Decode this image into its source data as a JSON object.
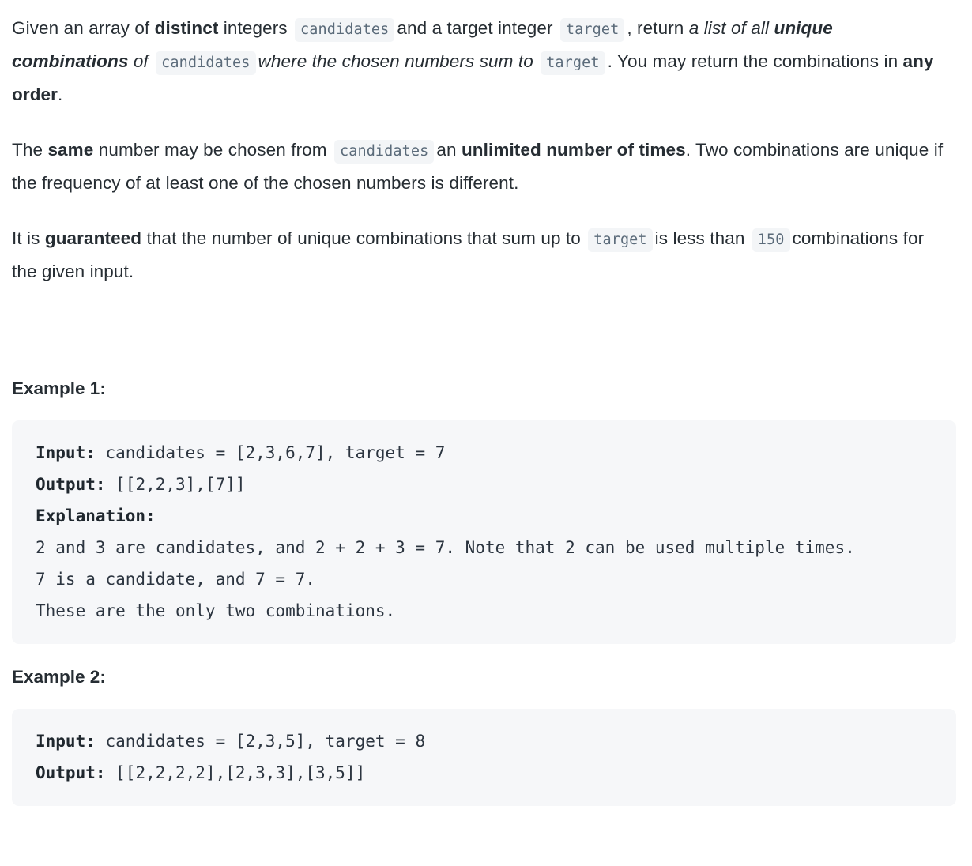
{
  "problem": {
    "paragraph1": {
      "seg1": "Given an array of ",
      "bold1": "distinct",
      "seg2": " integers ",
      "code1": "candidates",
      "seg3": "and a target integer ",
      "code2": "target",
      "seg4": ", return ",
      "italic1": "a list of all ",
      "bolditalic1": "unique combinations",
      "italic2": " of ",
      "code3": "candidates",
      "italic3": "where the chosen numbers sum to ",
      "code4": "target",
      "seg5": ".",
      "seg6": " You may return the combinations in ",
      "bold2": "any order",
      "seg7": "."
    },
    "paragraph2": {
      "seg1": "The ",
      "bold1": "same",
      "seg2": " number may be chosen from ",
      "code1": "candidates",
      "seg3": "an ",
      "bold2": "unlimited number of times",
      "seg4": ". Two combinations are unique if the frequency of at least one of the chosen numbers is different."
    },
    "paragraph3": {
      "seg1": "It is ",
      "bold1": "guaranteed",
      "seg2": " that the number of unique combinations that sum up to ",
      "code1": "target",
      "seg3": "is less than ",
      "code2": "150",
      "seg4": "combinations for the given input."
    }
  },
  "examples": [
    {
      "heading": "Example 1:",
      "input_label": "Input:",
      "input_value": " candidates = [2,3,6,7], target = 7",
      "output_label": "Output:",
      "output_value": " [[2,2,3],[7]]",
      "explanation_label": "Explanation:",
      "explanation_lines": [
        "2 and 3 are candidates, and 2 + 2 + 3 = 7. Note that 2 can be used multiple times.",
        "7 is a candidate, and 7 = 7.",
        "These are the only two combinations."
      ]
    },
    {
      "heading": "Example 2:",
      "input_label": "Input:",
      "input_value": " candidates = [2,3,5], target = 8",
      "output_label": "Output:",
      "output_value": " [[2,2,2,2],[2,3,3],[3,5]]",
      "explanation_label": "",
      "explanation_lines": []
    }
  ],
  "colors": {
    "text": "#262d33",
    "code_block_bg": "#f6f7f9",
    "inline_code_bg": "#f3f5f7",
    "inline_code_text": "#5b6b7a",
    "code_text": "#2c3540",
    "page_bg": "#ffffff"
  }
}
